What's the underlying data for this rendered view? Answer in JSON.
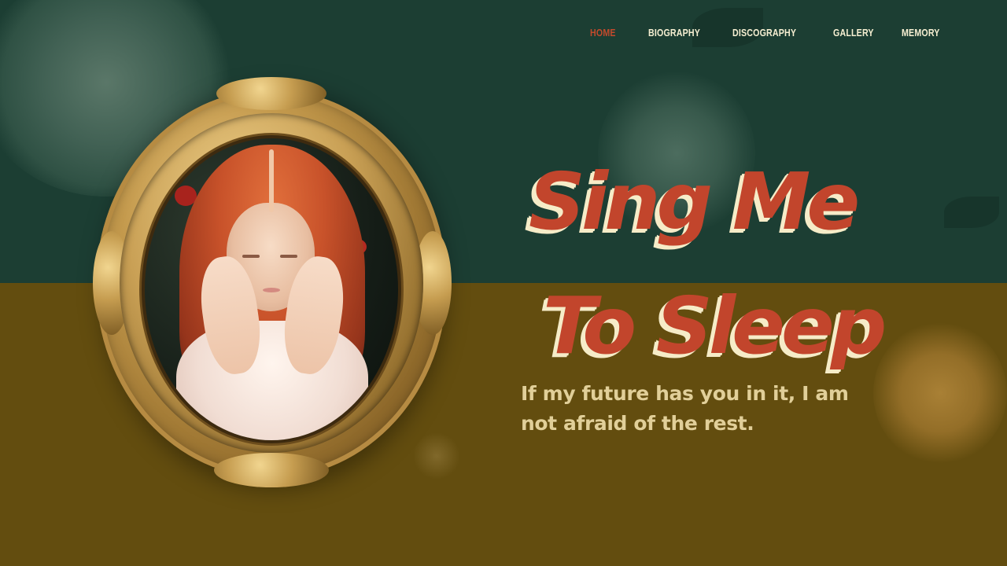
{
  "nav": {
    "items": [
      {
        "label": "HOME",
        "active": true
      },
      {
        "label": "BIOGRAPHY",
        "active": false
      },
      {
        "label": "DISCOGRAPHY",
        "active": false
      },
      {
        "label": "GALLERY",
        "active": false
      },
      {
        "label": "MEMORY",
        "active": false
      }
    ]
  },
  "hero": {
    "title_line1": "Sing Me",
    "title_line2": "To Sleep",
    "tagline": "If my future has you in it, I am not afraid of the rest."
  },
  "colors": {
    "top_background": "#1c3e33",
    "bottom_background": "#634d0f",
    "accent": "#c2452c",
    "title_highlight": "#f6ecc8",
    "tagline": "#e1cf99",
    "nav_text": "#f6efd2"
  }
}
